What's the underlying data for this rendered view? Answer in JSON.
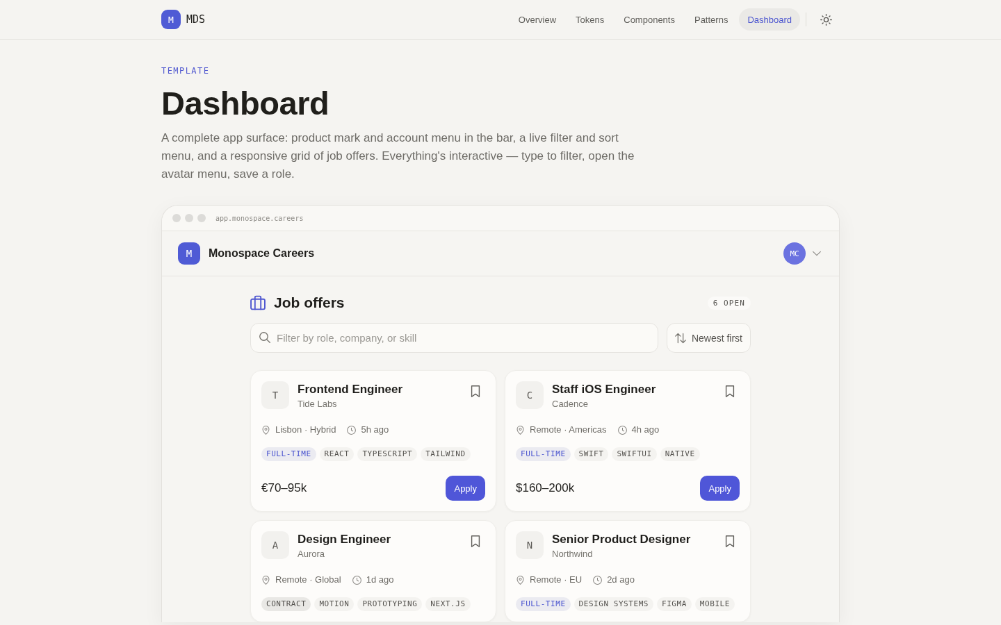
{
  "top_nav": {
    "logo_mark": "M",
    "brand": "MDS",
    "links": [
      {
        "label": "Overview",
        "selected": false
      },
      {
        "label": "Tokens",
        "selected": false
      },
      {
        "label": "Components",
        "selected": false
      },
      {
        "label": "Patterns",
        "selected": false
      },
      {
        "label": "Dashboard",
        "selected": true
      }
    ]
  },
  "header": {
    "eyebrow": "TEMPLATE",
    "title": "Dashboard",
    "description": "A complete app surface: product mark and account menu in the bar, a live filter and sort menu, and a responsive grid of job offers. Everything's interactive — type to filter, open the avatar menu, save a role."
  },
  "browser_window": {
    "url": "app.monospace.careers"
  },
  "app_bar": {
    "logo_mark": "M",
    "product_name": "Monospace Careers",
    "avatar_initials": "MC"
  },
  "job_offers": {
    "title": "Job offers",
    "count_badge": "6 OPEN",
    "search": {
      "placeholder": "Filter by role, company, or skill"
    },
    "sort_button": "Newest first",
    "cards": [
      {
        "logo_letter": "T",
        "title": "Frontend Engineer",
        "company": "Tide Labs",
        "saved": false,
        "location": "Lisbon · Hybrid",
        "posted": "5h ago",
        "tags": [
          {
            "label": "FULL-TIME",
            "kind": "accent"
          },
          {
            "label": "REACT",
            "kind": "skill"
          },
          {
            "label": "TYPESCRIPT",
            "kind": "skill"
          },
          {
            "label": "TAILWIND",
            "kind": "skill"
          }
        ],
        "salary": "€70–95k",
        "apply_button": "Apply"
      },
      {
        "logo_letter": "C",
        "title": "Staff iOS Engineer",
        "company": "Cadence",
        "saved": false,
        "location": "Remote · Americas",
        "posted": "4h ago",
        "tags": [
          {
            "label": "FULL-TIME",
            "kind": "accent"
          },
          {
            "label": "SWIFT",
            "kind": "skill"
          },
          {
            "label": "SWIFTUI",
            "kind": "skill"
          },
          {
            "label": "NATIVE",
            "kind": "skill"
          }
        ],
        "salary": "$160–200k",
        "apply_button": "Apply"
      },
      {
        "logo_letter": "A",
        "title": "Design Engineer",
        "company": "Aurora",
        "saved": false,
        "location": "Remote · Global",
        "posted": "1d ago",
        "tags": [
          {
            "label": "CONTRACT",
            "kind": "muted"
          },
          {
            "label": "MOTION",
            "kind": "skill"
          },
          {
            "label": "PROTOTYPING",
            "kind": "skill"
          },
          {
            "label": "NEXT.JS",
            "kind": "skill"
          }
        ]
      },
      {
        "logo_letter": "N",
        "title": "Senior Product Designer",
        "company": "Northwind",
        "saved": false,
        "location": "Remote · EU",
        "posted": "2d ago",
        "tags": [
          {
            "label": "FULL-TIME",
            "kind": "accent"
          },
          {
            "label": "DESIGN SYSTEMS",
            "kind": "skill"
          },
          {
            "label": "FIGMA",
            "kind": "skill"
          },
          {
            "label": "MOBILE",
            "kind": "skill"
          }
        ]
      }
    ]
  }
}
